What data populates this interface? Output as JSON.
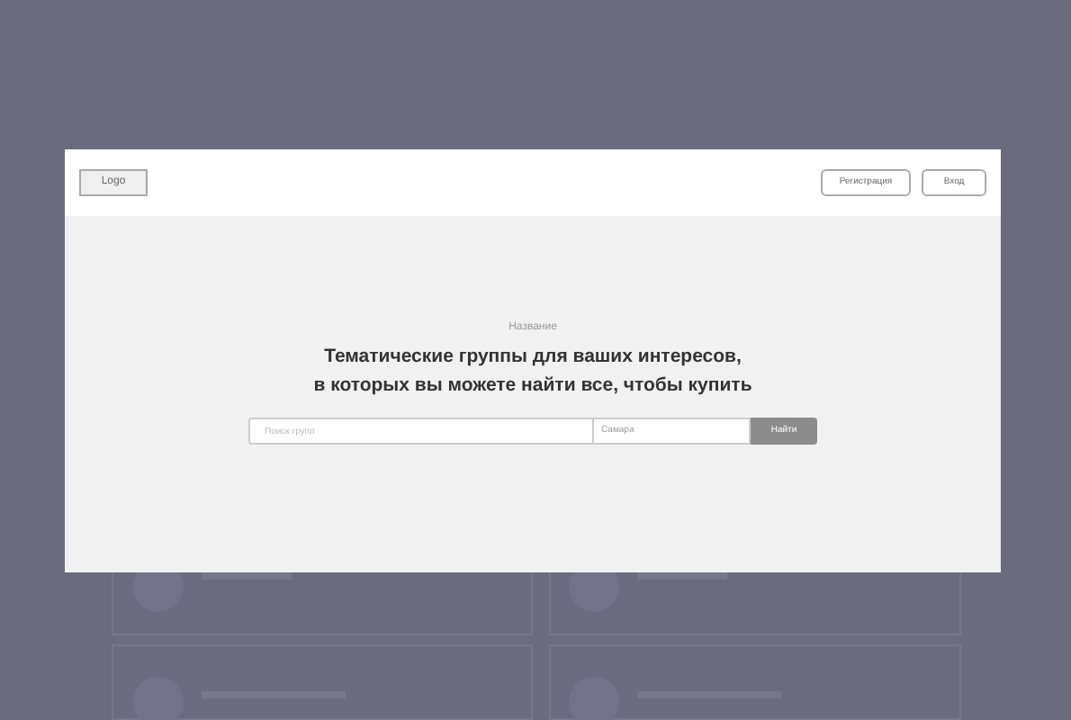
{
  "header": {
    "logo": "Logo",
    "buttons": [
      {
        "label": "Регистрация"
      },
      {
        "label": "Вход"
      }
    ]
  },
  "hero": {
    "caption": "Название",
    "heading_lines": [
      "Тематические группы для ваших интересов,",
      "в которых вы можете найти все, чтобы купить"
    ]
  },
  "search": {
    "placeholder": "Поиск групп",
    "city": "Самара",
    "button": "Найти"
  }
}
